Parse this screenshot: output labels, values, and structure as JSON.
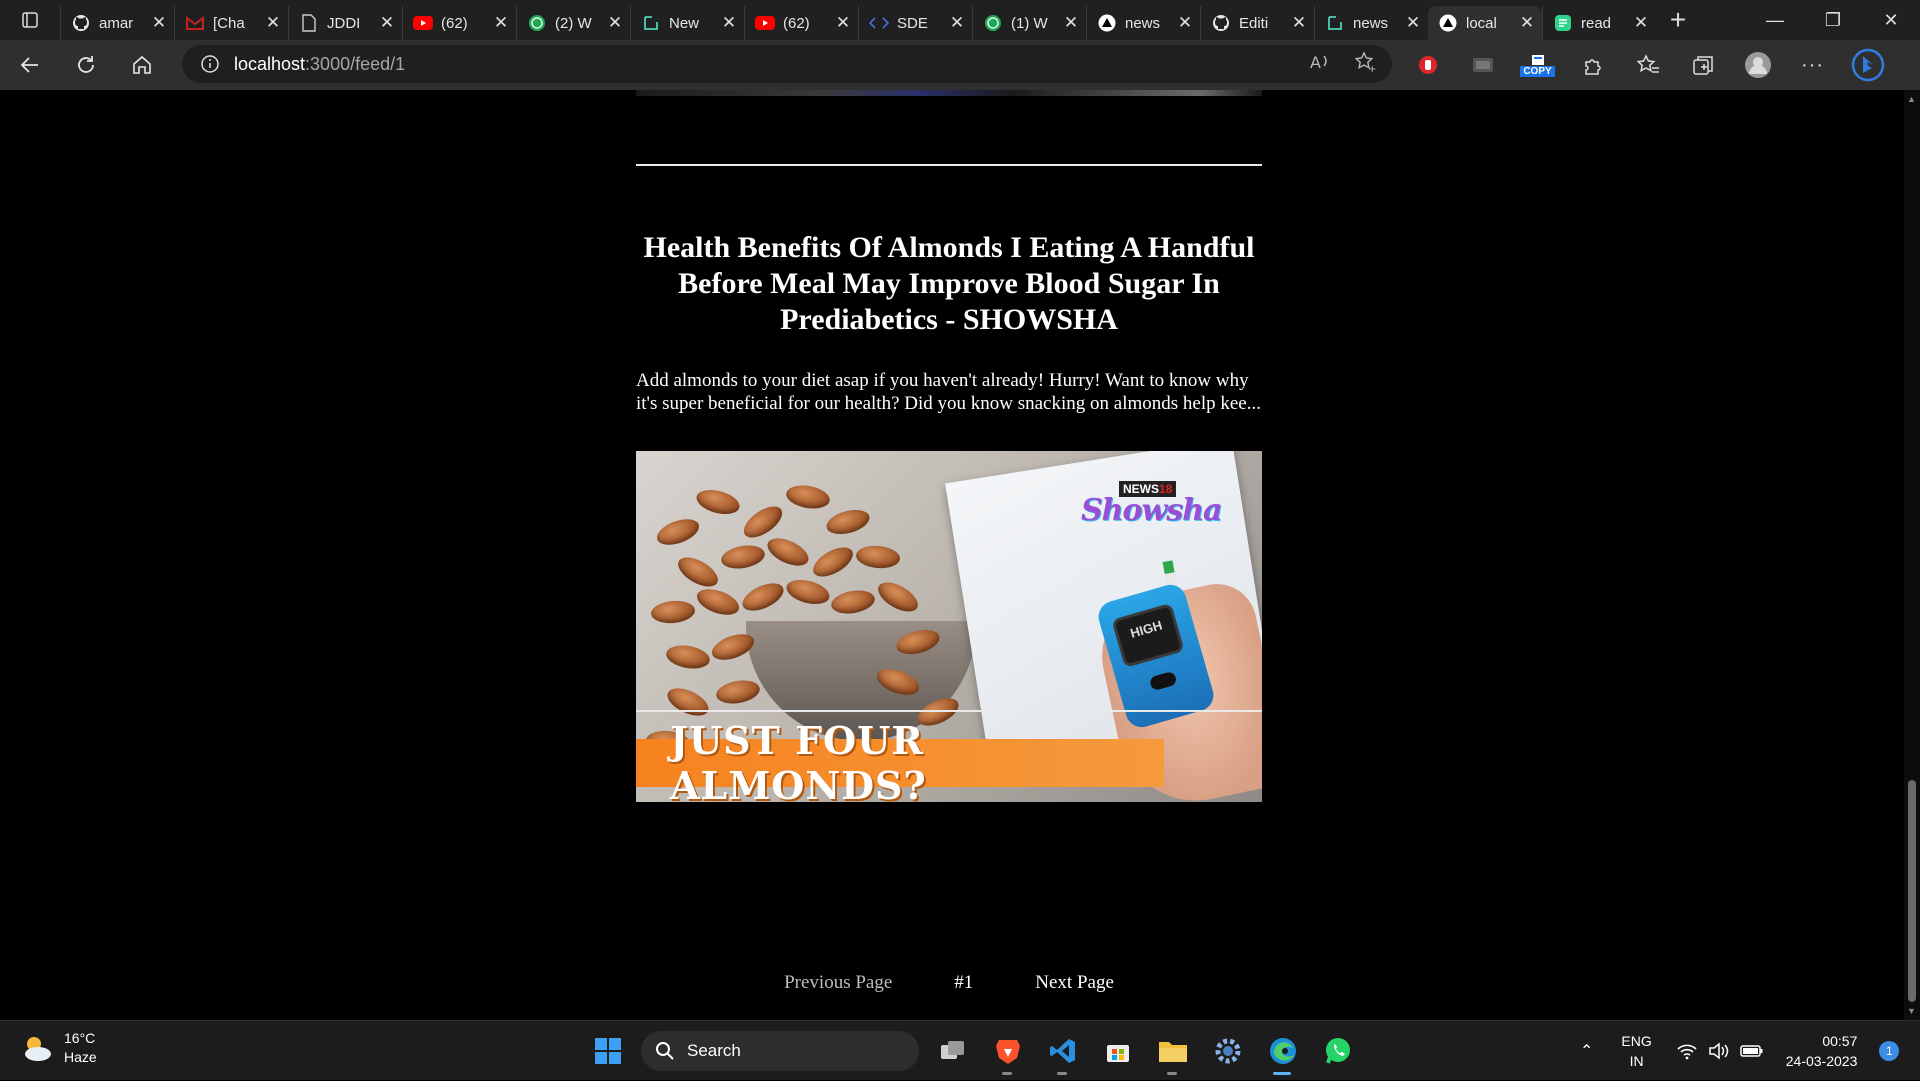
{
  "colors": {
    "background": "#000000",
    "tab_strip": "#202020",
    "toolbar": "#2f2f2f",
    "banner_orange": "#f6821f",
    "accent_blue": "#3a8ee6"
  },
  "tabs": [
    {
      "label": "amar",
      "icon": "github-icon"
    },
    {
      "label": "[Cha",
      "icon": "gmail-icon"
    },
    {
      "label": "JDDI",
      "icon": "document-icon"
    },
    {
      "label": "(62)",
      "icon": "youtube-icon"
    },
    {
      "label": "(2) W",
      "icon": "whatsapp-badge-icon"
    },
    {
      "label": "New",
      "icon": "codesandbox-icon"
    },
    {
      "label": "(62)",
      "icon": "youtube-icon"
    },
    {
      "label": "SDE",
      "icon": "code-icon"
    },
    {
      "label": "(1) W",
      "icon": "whatsapp-badge-icon"
    },
    {
      "label": "news",
      "icon": "vercel-icon"
    },
    {
      "label": "Editi",
      "icon": "github-icon"
    },
    {
      "label": "news",
      "icon": "codesandbox-icon"
    },
    {
      "label": "local",
      "icon": "vercel-icon",
      "active": true
    },
    {
      "label": "read",
      "icon": "readme-icon"
    }
  ],
  "address": {
    "host": "localhost",
    "path": ":3000/feed/1"
  },
  "toolbar": {
    "copy_label": "COPY"
  },
  "article": {
    "title": "Health Benefits Of Almonds I Eating A Handful Before Meal May Improve Blood Sugar In Prediabetics - SHOWSHA",
    "description": "Add almonds to your diet asap if you haven't already! Hurry! Want to know why it's super beneficial for our health? Did you know snacking on almonds help kee...",
    "image": {
      "banner_text": "JUST FOUR ALMONDS?",
      "brand_prefix": "NEWS",
      "brand_number": "18",
      "brand_name": "Showsha",
      "meter_text": "HIGH"
    }
  },
  "pagination": {
    "previous": "Previous Page",
    "current": "#1",
    "next": "Next Page"
  },
  "taskbar": {
    "weather_temp": "16°C",
    "weather_desc": "Haze",
    "search_label": "Search",
    "lang_top": "ENG",
    "lang_bottom": "IN",
    "time": "00:57",
    "date": "24-03-2023",
    "notification_count": "1"
  }
}
